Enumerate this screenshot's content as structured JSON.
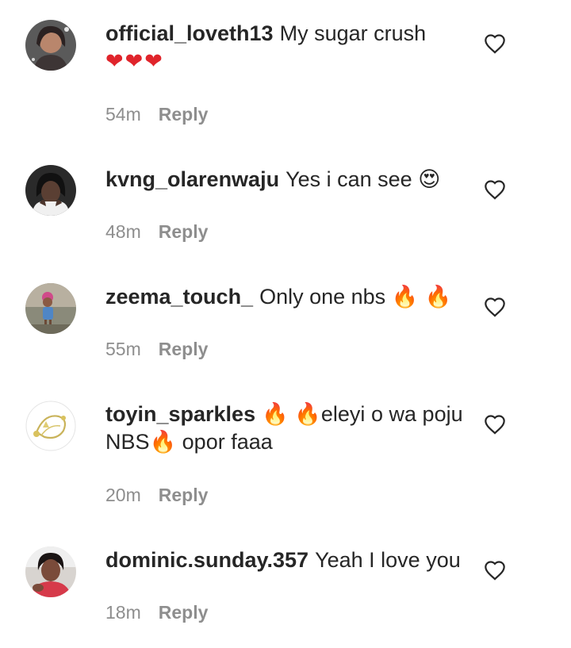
{
  "comments": [
    {
      "username": "official_loveth13",
      "text": "My sugar crush",
      "emoji": "❤❤❤",
      "time": "54m",
      "reply_label": "Reply",
      "like_icon": "heart-outline-icon"
    },
    {
      "username": "kvng_olarenwaju",
      "text": "Yes i can see",
      "emoji": "😍",
      "time": "48m",
      "reply_label": "Reply",
      "like_icon": "heart-outline-icon"
    },
    {
      "username": "zeema_touch_",
      "text": "Only one nbs",
      "emoji": "🔥 🔥",
      "time": "55m",
      "reply_label": "Reply",
      "like_icon": "heart-outline-icon"
    },
    {
      "username": "toyin_sparkles",
      "text_part1": "🔥 🔥eleyi o wa poju NBS🔥",
      "text_part2": " opor faaa",
      "time": "20m",
      "reply_label": "Reply",
      "like_icon": "heart-outline-icon"
    },
    {
      "username": "dominic.sunday.357",
      "text": "Yeah I love you",
      "time": "18m",
      "reply_label": "Reply",
      "like_icon": "heart-outline-icon"
    }
  ],
  "colors": {
    "text": "#262626",
    "meta": "#8e8e8e",
    "heart_emoji": "#e0242b",
    "fire_emoji": "#f46a1c"
  }
}
